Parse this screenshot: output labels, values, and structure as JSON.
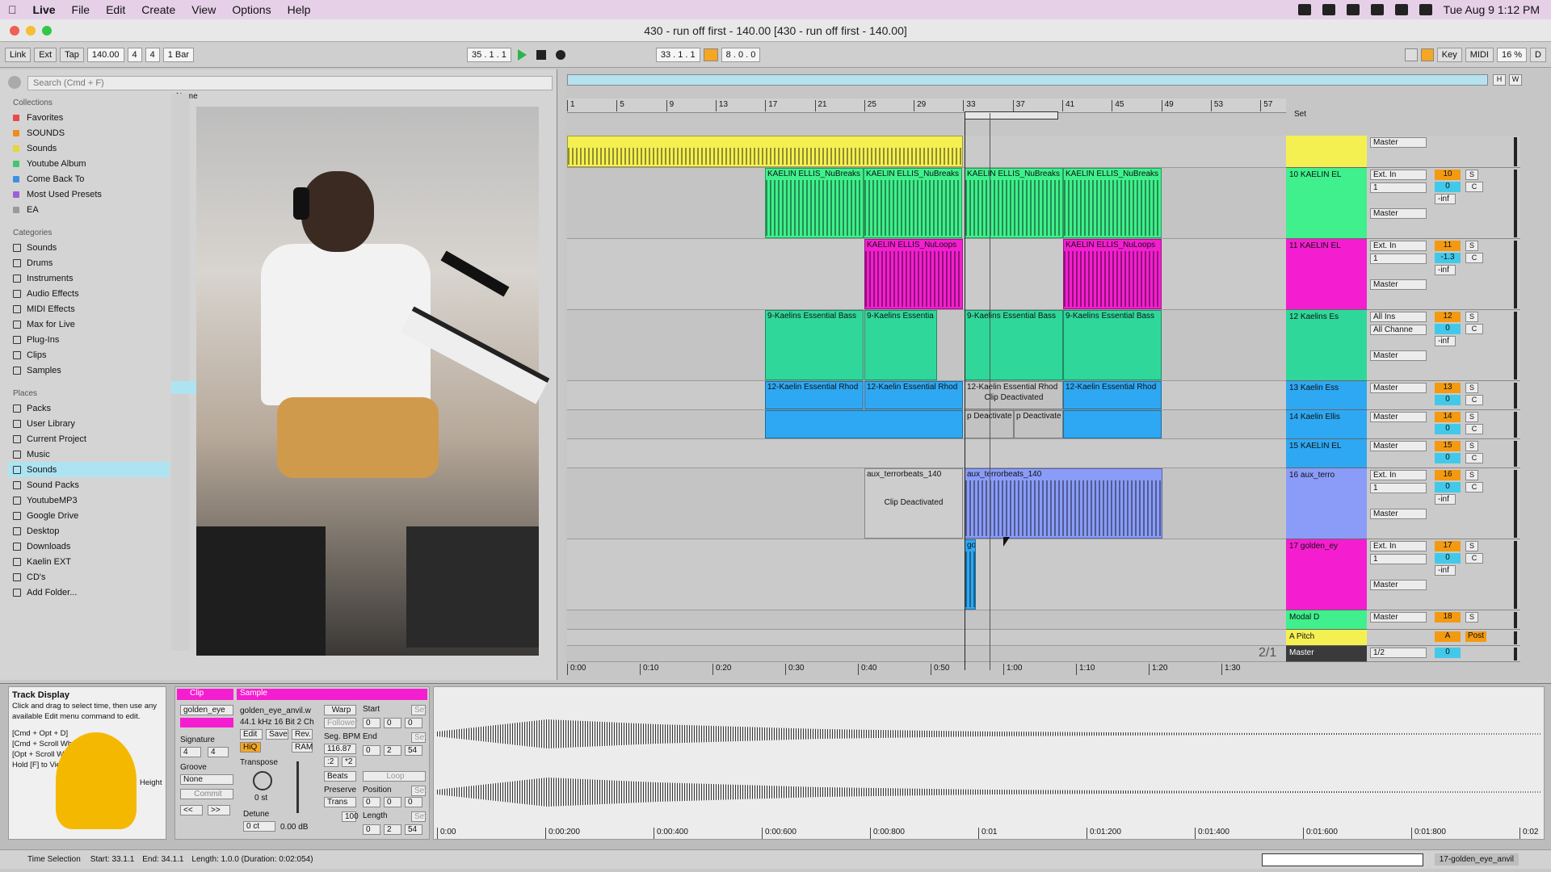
{
  "menubar": {
    "app": "Live",
    "items": [
      "File",
      "Edit",
      "Create",
      "View",
      "Options",
      "Help"
    ],
    "clock": "Tue Aug 9  1:12 PM"
  },
  "window": {
    "title": "430 - run off first - 140.00  [430 - run off first - 140.00]"
  },
  "control": {
    "link": "Link",
    "ext": "Ext",
    "tap": "Tap",
    "tempo": "140.00",
    "sig_num": "4",
    "sig_den": "4",
    "quant": "1 Bar",
    "pos": "35 .  1 .  1",
    "loop_start": "33 .  1 .  1",
    "loop_len": "8 .  0 .  0",
    "key": "Key",
    "midi": "MIDI",
    "cpu": "16 %",
    "d": "D"
  },
  "browser": {
    "search_placeholder": "Search (Cmd + F)",
    "collections_header": "Collections",
    "collections": [
      {
        "label": "Favorites",
        "color": "#e84a4a"
      },
      {
        "label": "SOUNDS",
        "color": "#f08a1c"
      },
      {
        "label": "Sounds",
        "color": "#e9d43a"
      },
      {
        "label": "Youtube Album",
        "color": "#45c66b"
      },
      {
        "label": "Come Back To",
        "color": "#3f8fe0"
      },
      {
        "label": "Most Used Presets",
        "color": "#9b62d6"
      },
      {
        "label": "EA",
        "color": "#9a9a9a"
      }
    ],
    "categories_header": "Categories",
    "categories": [
      "Sounds",
      "Drums",
      "Instruments",
      "Audio Effects",
      "MIDI Effects",
      "Max for Live",
      "Plug-Ins",
      "Clips",
      "Samples"
    ],
    "places_header": "Places",
    "places": [
      "Packs",
      "User Library",
      "Current Project",
      "Music",
      "Sounds",
      "Sound Packs",
      "YoutubeMP3",
      "Google Drive",
      "Desktop",
      "Downloads",
      "Kaelin EXT",
      "CD's",
      "Add Folder..."
    ],
    "name_header": "Name"
  },
  "ruler": [
    "1",
    "5",
    "9",
    "13",
    "17",
    "21",
    "25",
    "29",
    "33",
    "37",
    "41",
    "45",
    "49",
    "53",
    "57"
  ],
  "time_ruler": [
    "0:00",
    "0:10",
    "0:20",
    "0:30",
    "0:40",
    "0:50",
    "1:00",
    "1:10",
    "1:20",
    "1:30"
  ],
  "tracks": [
    {
      "name": "",
      "color": "#f5f052",
      "input": "",
      "monitor": "",
      "out": "Master",
      "num": "",
      "vol": ""
    },
    {
      "name": "10 KAELIN EL",
      "color": "#3ff08c",
      "input": "Ext. In",
      "channel": "1",
      "out": "Master",
      "num": "10",
      "vol": "0",
      "pan": "C",
      "peak": "-inf"
    },
    {
      "name": "11 KAELIN EL",
      "color": "#f41ed0",
      "input": "Ext. In",
      "channel": "1",
      "out": "Master",
      "num": "11",
      "vol": "-1.3",
      "pan": "C",
      "peak": "-inf"
    },
    {
      "name": "12 Kaelins Es",
      "color": "#2fd89a",
      "input": "All Ins",
      "channel": "All Channe",
      "out": "Master",
      "num": "12",
      "vol": "0",
      "pan": "C",
      "peak": "-inf"
    },
    {
      "name": "13 Kaelin Ess",
      "color": "#2ea8f2",
      "out": "Master",
      "num": "13",
      "vol": "0",
      "pan": "C"
    },
    {
      "name": "14 Kaelin Ellis",
      "color": "#2ea8f2",
      "out": "Master",
      "num": "14",
      "vol": "0",
      "pan": "C"
    },
    {
      "name": "15 KAELIN EL",
      "color": "#2ea8f2",
      "out": "Master",
      "num": "15",
      "vol": "0",
      "pan": "C"
    },
    {
      "name": "16 aux_terro",
      "color": "#8a9cf8",
      "input": "Ext. In",
      "channel": "1",
      "out": "Master",
      "num": "16",
      "vol": "0",
      "pan": "C",
      "peak": "-inf"
    },
    {
      "name": "17 golden_ey",
      "color": "#f41ed0",
      "input": "Ext. In",
      "channel": "1",
      "out": "Master",
      "num": "17",
      "vol": "0",
      "pan": "C",
      "peak": "-inf"
    },
    {
      "name": "Modal D",
      "color": "#3ff08c",
      "out": "Master",
      "num": "18"
    },
    {
      "name": "A Pitch",
      "color": "#f5f052",
      "num": "A",
      "post": "Post"
    },
    {
      "name": "Master",
      "color": "#3a3a3a",
      "out": "1/2",
      "num": "0",
      "vol": "0"
    }
  ],
  "clips": {
    "kaelin_nubreaks": "KAELIN ELLIS_NuBreaks",
    "kaelin_nuloops": "KAELIN ELLIS_NuLoops",
    "essential_bass": "9-Kaelins Essential Bass",
    "essential_bass_short": "9-Kaelins Essentia",
    "essential_rhodes": "12-Kaelin Essential Rhod",
    "deactivated": "Clip Deactivated",
    "deactivated_short": "p Deactivate",
    "aux": "aux_terrorbeats_140",
    "golden": "go"
  },
  "set_label": "Set",
  "page_counter": "2/1",
  "info": {
    "title": "Track Display",
    "body": "Click and drag to select time, then use any available Edit menu command to edit.",
    "shortcuts": [
      "[Cmd + Opt + D]",
      "[Cmd + Scroll Wh",
      "[Opt + Scroll Whee",
      "Hold [F] to View a"
    ],
    "height": "Height"
  },
  "clipview": {
    "clip_label": "Clip",
    "sample_label": "Sample",
    "clip_name": "golden_eye",
    "file": "golden_eye_anvil.w",
    "fileinfo": "44.1 kHz 16 Bit 2 Ch",
    "warp": "Warp",
    "follower": "Follower",
    "edit": "Edit",
    "save": "Save",
    "rev": "Rev.",
    "hiq": "HiQ",
    "ram": "RAM",
    "seg_bpm_label": "Seg. BPM",
    "seg_bpm": "116.87",
    "signature": "Signature",
    "sig_num": "4",
    "sig_den": "4",
    "groove": "Groove",
    "groove_val": "None",
    "commit": "Commit",
    "transpose": "Transpose",
    "transpose_val": "0 st",
    "detune": "Detune",
    "detune_val": "0 ct",
    "gain": "0.00 dB",
    "beats": "Beats",
    "preserve": "Preserve",
    "trans": "Trans",
    "start": "Start",
    "end": "End",
    "loop": "Loop",
    "position": "Position",
    "length": "Length",
    "set": "Set",
    "start_val": [
      "0",
      "0",
      "0"
    ],
    "end_val": [
      "0",
      "2",
      "54"
    ],
    "pos_val": [
      "0",
      "0",
      "0"
    ],
    "len_val": [
      "0",
      "2",
      "54"
    ],
    "half": ":2",
    "dbl": "*2",
    "prev": "<<",
    "next": ">>",
    "hundred": "100"
  },
  "sample_ruler": [
    "0:00",
    "0:00:200",
    "0:00:400",
    "0:00:600",
    "0:00:800",
    "0:01",
    "0:01:200",
    "0:01:400",
    "0:01:600",
    "0:01:800",
    "0:02"
  ],
  "status": {
    "mode": "Time Selection",
    "start": "Start: 33.1.1",
    "end": "End: 34.1.1",
    "length": "Length: 1.0.0 (Duration: 0:02:054)",
    "track": "17-golden_eye_anvil"
  }
}
